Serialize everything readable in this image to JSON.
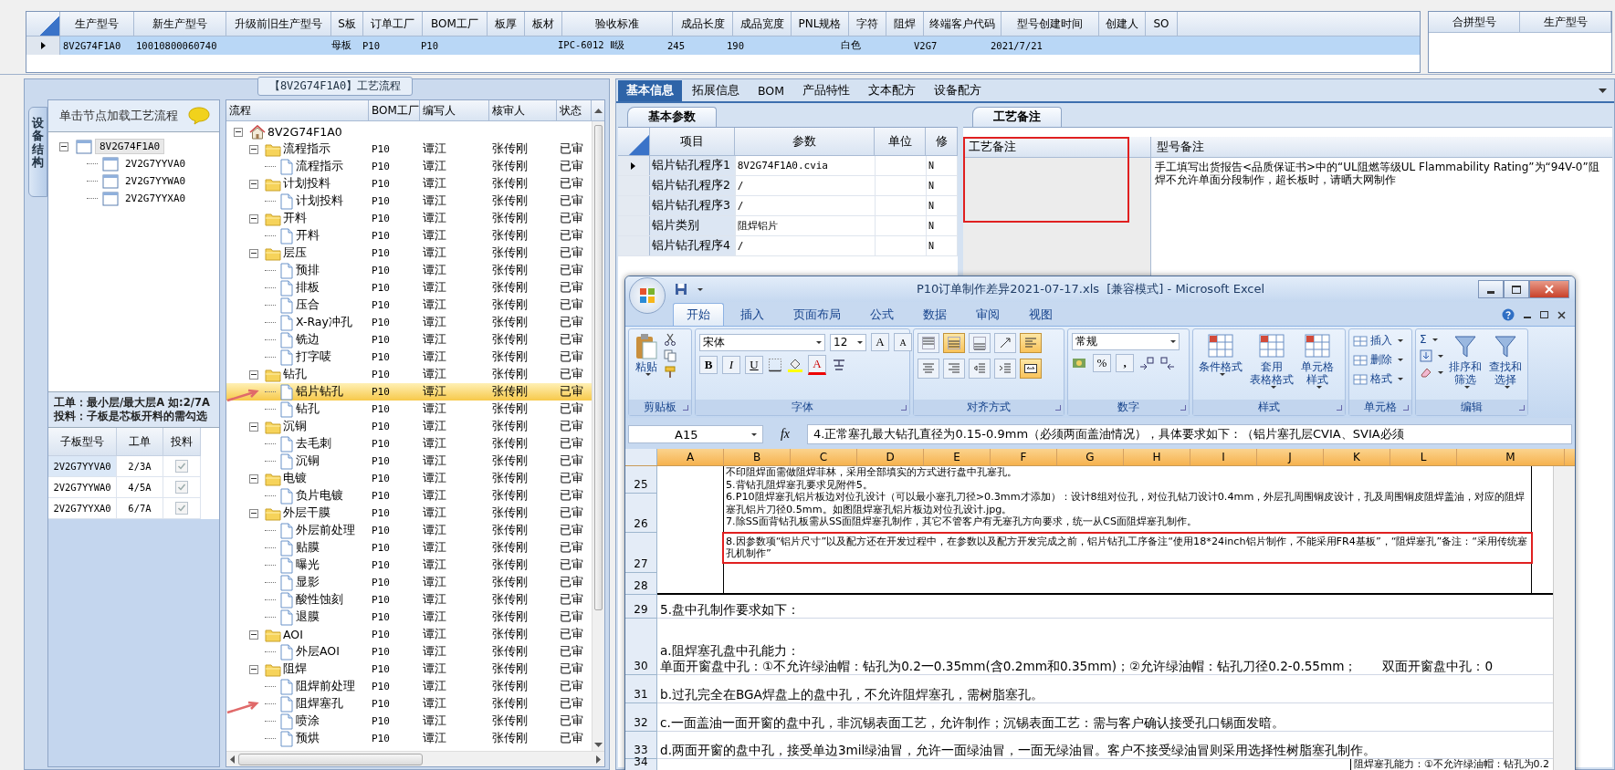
{
  "top_grid": {
    "columns": [
      "生产型号",
      "新生产型号",
      "升级前旧生产型号",
      "S板",
      "订单工厂",
      "BOM工厂",
      "板厚",
      "板材",
      "验收标准",
      "成品长度",
      "成品宽度",
      "PNL规格",
      "字符",
      "阻焊",
      "终端客户代码",
      "型号创建时间",
      "创建人",
      "SO"
    ],
    "rows": [
      {
        "current": true,
        "selected": true,
        "cells": [
          "8V2G74F1A0",
          "10010800060740",
          null,
          "母板",
          "P10",
          "P10",
          null,
          null,
          "IPC-6012 Ⅱ级",
          "245",
          "190",
          null,
          "白色",
          null,
          "V2G7",
          "2021/7/21",
          null,
          null
        ]
      }
    ]
  },
  "merge_grid": {
    "columns": [
      "合拼型号",
      "生产型号"
    ]
  },
  "process_panel_title": "【8V2G74F1A0】工艺流程",
  "side_tab": "设备结构",
  "device_tree": {
    "hint": "单击节点加载工艺流程",
    "root": {
      "label": "8V2G74F1A0",
      "kind": "board",
      "expanded": true,
      "selected": true,
      "children": [
        {
          "label": "2V2G7YYVA0",
          "kind": "board",
          "selected": false
        },
        {
          "label": "2V2G7YYWA0",
          "kind": "board",
          "selected": false
        },
        {
          "label": "2V2G7YYXA0",
          "kind": "board",
          "selected": false
        }
      ]
    }
  },
  "note": [
    "工单：最小层/最大层A 如:2/7A",
    "投料：子板是芯板开料的需勾选"
  ],
  "sub_boards": {
    "columns": [
      "子板型号",
      "工单",
      "投料"
    ],
    "rows": [
      {
        "model": "2V2G7YYVA0",
        "order": "2/3A",
        "feed": true,
        "selected": true
      },
      {
        "model": "2V2G7YYWA0",
        "order": "4/5A",
        "feed": true,
        "selected": false
      },
      {
        "model": "2V2G7YYXA0",
        "order": "6/7A",
        "feed": true,
        "selected": false
      }
    ]
  },
  "process_tree": {
    "columns": [
      "流程",
      "BOM工厂",
      "编写人",
      "核审人",
      "状态"
    ],
    "root": {
      "label": "8V2G74F1A0",
      "kind": "root",
      "expanded": true,
      "selected": false,
      "children": [
        {
          "label": "流程指示",
          "kind": "folder",
          "expanded": true,
          "selected": false,
          "bom": "P10",
          "writer": "谭江",
          "reviewer": "张传刚",
          "status": "已审",
          "children": [
            {
              "label": "流程指示",
              "kind": "file",
              "selected": false,
              "bom": "P10",
              "writer": "谭江",
              "reviewer": "张传刚",
              "status": "已审"
            }
          ]
        },
        {
          "label": "计划投料",
          "kind": "folder",
          "expanded": true,
          "selected": false,
          "bom": "P10",
          "writer": "谭江",
          "reviewer": "张传刚",
          "status": "已审",
          "children": [
            {
              "label": "计划投料",
              "kind": "file",
              "selected": false,
              "bom": "P10",
              "writer": "谭江",
              "reviewer": "张传刚",
              "status": "已审"
            }
          ]
        },
        {
          "label": "开料",
          "kind": "folder",
          "expanded": true,
          "selected": false,
          "bom": "P10",
          "writer": "谭江",
          "reviewer": "张传刚",
          "status": "已审",
          "children": [
            {
              "label": "开料",
              "kind": "file",
              "selected": false,
              "bom": "P10",
              "writer": "谭江",
              "reviewer": "张传刚",
              "status": "已审"
            }
          ]
        },
        {
          "label": "层压",
          "kind": "folder",
          "expanded": true,
          "selected": false,
          "bom": "P10",
          "writer": "谭江",
          "reviewer": "张传刚",
          "status": "已审",
          "children": [
            {
              "label": "预排",
              "kind": "file",
              "selected": false,
              "bom": "P10",
              "writer": "谭江",
              "reviewer": "张传刚",
              "status": "已审"
            },
            {
              "label": "排板",
              "kind": "file",
              "selected": false,
              "bom": "P10",
              "writer": "谭江",
              "reviewer": "张传刚",
              "status": "已审"
            },
            {
              "label": "压合",
              "kind": "file",
              "selected": false,
              "bom": "P10",
              "writer": "谭江",
              "reviewer": "张传刚",
              "status": "已审"
            },
            {
              "label": "X-Ray冲孔",
              "kind": "file",
              "selected": false,
              "bom": "P10",
              "writer": "谭江",
              "reviewer": "张传刚",
              "status": "已审"
            },
            {
              "label": "铣边",
              "kind": "file",
              "selected": false,
              "bom": "P10",
              "writer": "谭江",
              "reviewer": "张传刚",
              "status": "已审"
            },
            {
              "label": "打字唛",
              "kind": "file",
              "selected": false,
              "bom": "P10",
              "writer": "谭江",
              "reviewer": "张传刚",
              "status": "已审"
            }
          ]
        },
        {
          "label": "钻孔",
          "kind": "folder",
          "expanded": true,
          "selected": false,
          "bom": "P10",
          "writer": "谭江",
          "reviewer": "张传刚",
          "status": "已审",
          "children": [
            {
              "label": "铝片钻孔",
              "kind": "file",
              "selected": true,
              "pointed": true,
              "bom": "P10",
              "writer": "谭江",
              "reviewer": "张传刚",
              "status": "已审"
            },
            {
              "label": "钻孔",
              "kind": "file",
              "selected": false,
              "bom": "P10",
              "writer": "谭江",
              "reviewer": "张传刚",
              "status": "已审"
            }
          ]
        },
        {
          "label": "沉铜",
          "kind": "folder",
          "expanded": true,
          "selected": false,
          "bom": "P10",
          "writer": "谭江",
          "reviewer": "张传刚",
          "status": "已审",
          "children": [
            {
              "label": "去毛刺",
              "kind": "file",
              "selected": false,
              "bom": "P10",
              "writer": "谭江",
              "reviewer": "张传刚",
              "status": "已审"
            },
            {
              "label": "沉铜",
              "kind": "file",
              "selected": false,
              "bom": "P10",
              "writer": "谭江",
              "reviewer": "张传刚",
              "status": "已审"
            }
          ]
        },
        {
          "label": "电镀",
          "kind": "folder",
          "expanded": true,
          "selected": false,
          "bom": "P10",
          "writer": "谭江",
          "reviewer": "张传刚",
          "status": "已审",
          "children": [
            {
              "label": "负片电镀",
              "kind": "file",
              "selected": false,
              "bom": "P10",
              "writer": "谭江",
              "reviewer": "张传刚",
              "status": "已审"
            }
          ]
        },
        {
          "label": "外层干膜",
          "kind": "folder",
          "expanded": true,
          "selected": false,
          "bom": "P10",
          "writer": "谭江",
          "reviewer": "张传刚",
          "status": "已审",
          "children": [
            {
              "label": "外层前处理",
              "kind": "file",
              "selected": false,
              "bom": "P10",
              "writer": "谭江",
              "reviewer": "张传刚",
              "status": "已审"
            },
            {
              "label": "贴膜",
              "kind": "file",
              "selected": false,
              "bom": "P10",
              "writer": "谭江",
              "reviewer": "张传刚",
              "status": "已审"
            },
            {
              "label": "曝光",
              "kind": "file",
              "selected": false,
              "bom": "P10",
              "writer": "谭江",
              "reviewer": "张传刚",
              "status": "已审"
            },
            {
              "label": "显影",
              "kind": "file",
              "selected": false,
              "bom": "P10",
              "writer": "谭江",
              "reviewer": "张传刚",
              "status": "已审"
            },
            {
              "label": "酸性蚀刻",
              "kind": "file",
              "selected": false,
              "bom": "P10",
              "writer": "谭江",
              "reviewer": "张传刚",
              "status": "已审"
            },
            {
              "label": "退膜",
              "kind": "file",
              "selected": false,
              "bom": "P10",
              "writer": "谭江",
              "reviewer": "张传刚",
              "status": "已审"
            }
          ]
        },
        {
          "label": "AOI",
          "kind": "folder",
          "expanded": true,
          "selected": false,
          "bom": "P10",
          "writer": "谭江",
          "reviewer": "张传刚",
          "status": "已审",
          "children": [
            {
              "label": "外层AOI",
              "kind": "file",
              "selected": false,
              "bom": "P10",
              "writer": "谭江",
              "reviewer": "张传刚",
              "status": "已审"
            }
          ]
        },
        {
          "label": "阻焊",
          "kind": "folder",
          "expanded": true,
          "selected": false,
          "bom": "P10",
          "writer": "谭江",
          "reviewer": "张传刚",
          "status": "已审",
          "children": [
            {
              "label": "阻焊前处理",
              "kind": "file",
              "selected": false,
              "bom": "P10",
              "writer": "谭江",
              "reviewer": "张传刚",
              "status": "已审"
            },
            {
              "label": "阻焊塞孔",
              "kind": "file",
              "selected": false,
              "pointed": true,
              "bom": "P10",
              "writer": "谭江",
              "reviewer": "张传刚",
              "status": "已审"
            },
            {
              "label": "喷涂",
              "kind": "file",
              "selected": false,
              "bom": "P10",
              "writer": "谭江",
              "reviewer": "张传刚",
              "status": "已审"
            },
            {
              "label": "预烘",
              "kind": "file",
              "selected": false,
              "bom": "P10",
              "writer": "谭江",
              "reviewer": "张传刚",
              "status": "已审"
            }
          ]
        }
      ]
    }
  },
  "right_tabs": [
    {
      "label": "基本信息",
      "selected": true
    },
    {
      "label": "拓展信息",
      "selected": false
    },
    {
      "label": "BOM",
      "selected": false
    },
    {
      "label": "产品特性",
      "selected": false
    },
    {
      "label": "文本配方",
      "selected": false
    },
    {
      "label": "设备配方",
      "selected": false
    }
  ],
  "basic_params": {
    "tab": "基本参数",
    "columns": [
      "项目",
      "参数",
      "单位",
      "修"
    ],
    "rows": [
      {
        "current": true,
        "item": "铝片钻孔程序1",
        "value": "8V2G74F1A0.cvia",
        "changed": "N"
      },
      {
        "current": false,
        "item": "铝片钻孔程序2",
        "value": "/",
        "changed": "N"
      },
      {
        "current": false,
        "item": "铝片钻孔程序3",
        "value": "/",
        "changed": "N"
      },
      {
        "current": false,
        "item": "铝片类别",
        "value": "阻焊铝片",
        "changed": "N"
      },
      {
        "current": false,
        "item": "铝片钻孔程序4",
        "value": "/",
        "changed": "N"
      }
    ]
  },
  "remarks": {
    "tab": "工艺备注",
    "columns": [
      "工艺备注",
      "型号备注"
    ],
    "annotated": true,
    "model_note": "手工填写出货报告<品质保证书>中的“UL阻燃等级UL Flammability Rating”为“94V-0”阻焊不允许单面分段制作，超长板时，请晒大网制作"
  },
  "excel": {
    "title": "P10订单制作差异2021-07-17.xls  [兼容模式] - Microsoft Excel",
    "tabs": [
      {
        "label": "开始",
        "selected": true
      },
      {
        "label": "插入",
        "selected": false
      },
      {
        "label": "页面布局",
        "selected": false
      },
      {
        "label": "公式",
        "selected": false
      },
      {
        "label": "数据",
        "selected": false
      },
      {
        "label": "审阅",
        "selected": false
      },
      {
        "label": "视图",
        "selected": false
      }
    ],
    "groups": [
      {
        "kind": "clipboard",
        "label": "剪贴板",
        "paste": "粘贴"
      },
      {
        "kind": "font",
        "label": "字体",
        "font": "宋体",
        "size": "12",
        "grow": "A",
        "shrink": "A",
        "bold": "B",
        "italic": "I",
        "underline": "U",
        "color_letter": "A"
      },
      {
        "kind": "align",
        "label": "对齐方式",
        "buttons": [
          {
            "kind": "top",
            "pressed": false
          },
          {
            "kind": "middle",
            "pressed": true
          },
          {
            "kind": "bottom",
            "pressed": false
          },
          {
            "kind": "orient",
            "pressed": false
          },
          {
            "kind": "left",
            "pressed": true
          },
          {
            "kind": "center",
            "pressed": false
          },
          {
            "kind": "right",
            "pressed": false
          },
          {
            "kind": "outdent",
            "pressed": false
          },
          {
            "kind": "indent",
            "pressed": false
          },
          {
            "kind": "merge",
            "pressed": true
          }
        ]
      },
      {
        "kind": "number",
        "label": "数字",
        "format": "常规",
        "percent": "%",
        "comma": ","
      },
      {
        "kind": "styles",
        "label": "样式",
        "buttons": [
          [
            "条件格式"
          ],
          [
            "套用",
            "表格格式"
          ],
          [
            "单元格",
            "样式"
          ]
        ]
      },
      {
        "kind": "cells",
        "label": "单元格",
        "buttons": [
          "插入",
          "删除",
          "格式"
        ]
      },
      {
        "kind": "editing",
        "label": "编辑",
        "sigma": "Σ",
        "buttons": [
          [
            "排序和",
            "筛选"
          ],
          [
            "查找和",
            "选择"
          ]
        ]
      }
    ],
    "name_box": "A15",
    "fx": "fx",
    "formula": "4.正常塞孔最大钻孔直径为0.15-0.9mm（必须两面盖油情况），具体要求如下：（铝片塞孔层CVIA、SVIA必须",
    "columns": [
      "A",
      "B",
      "C",
      "D",
      "E",
      "F",
      "G",
      "H",
      "I",
      "J",
      "K",
      "L",
      "M"
    ],
    "merged_paragraphs": [
      {
        "text": "不印阻焊面需做阻焊菲林，采用全部填实的方式进行盘中孔塞孔。",
        "annotated": false
      },
      {
        "text": "5.背钻孔阻焊塞孔要求见附件5。",
        "annotated": false
      },
      {
        "text": "6.P10阻焊塞孔铝片板边对位孔设计（可以最小塞孔刀径>0.3mm才添加）：设计8组对位孔，对位孔钻刀设计0.4mm，外层孔周围铜皮设计，孔及周围铜皮阻焊盖油，对应的阻焊塞孔铝片刀径0.5mm。如图阻焊塞孔铝片板边对位孔设计.jpg。",
        "annotated": false
      },
      {
        "text": "7.除SS面背钻孔板需从SS面阻焊塞孔制作，其它不管客户有无塞孔方向要求，统一从CS面阻焊塞孔制作。",
        "annotated": false
      },
      {
        "text": "8.因参数项“铝片尺寸”以及配方还在开发过程中，在参数以及配方开发完成之前，铝片钻孔工序备注“使用18*24inch铝片制作，不能采用FR4基板”，“阻焊塞孔”备注：“采用传统塞孔机制作”",
        "annotated": true
      }
    ],
    "rows": [
      {
        "number": "25",
        "kind": "merged"
      },
      {
        "number": "26",
        "kind": "merged"
      },
      {
        "number": "27",
        "kind": "merged"
      },
      {
        "number": "28",
        "kind": "merged"
      },
      {
        "number": "29",
        "kind": "text",
        "lines": [
          "5.盘中孔制作要求如下："
        ]
      },
      {
        "number": "30",
        "kind": "text",
        "lines": [
          "a.阻焊塞孔盘中孔能力：",
          "单面开窗盘中孔：①不允许绿油帽：钻孔为0.2一0.35mm(含0.2mm和0.35mm)；②允许绿油帽：钻孔刀径0.2-0.55mm；　　双面开窗盘中孔：0"
        ]
      },
      {
        "number": "31",
        "kind": "text",
        "lines": [
          "b.过孔完全在BGA焊盘上的盘中孔，不允许阻焊塞孔，需树脂塞孔。"
        ]
      },
      {
        "number": "32",
        "kind": "text",
        "lines": [
          "c.一面盖油一面开窗的盘中孔，非沉锡表面工艺，允许制作；沉锡表面工艺：需与客户确认接受孔口锡面发暗。"
        ]
      },
      {
        "number": "33",
        "kind": "text",
        "lines": [
          "d.两面开窗的盘中孔，接受单边3mil绿油冒，允许一面绿油冒，一面无绿油冒。客户不接受绿油冒则采用选择性树脂塞孔制作。"
        ]
      },
      {
        "number": "34",
        "kind": "side",
        "text": "阻焊塞孔能力：①不允许绿油帽：钻孔为0.2"
      }
    ]
  }
}
